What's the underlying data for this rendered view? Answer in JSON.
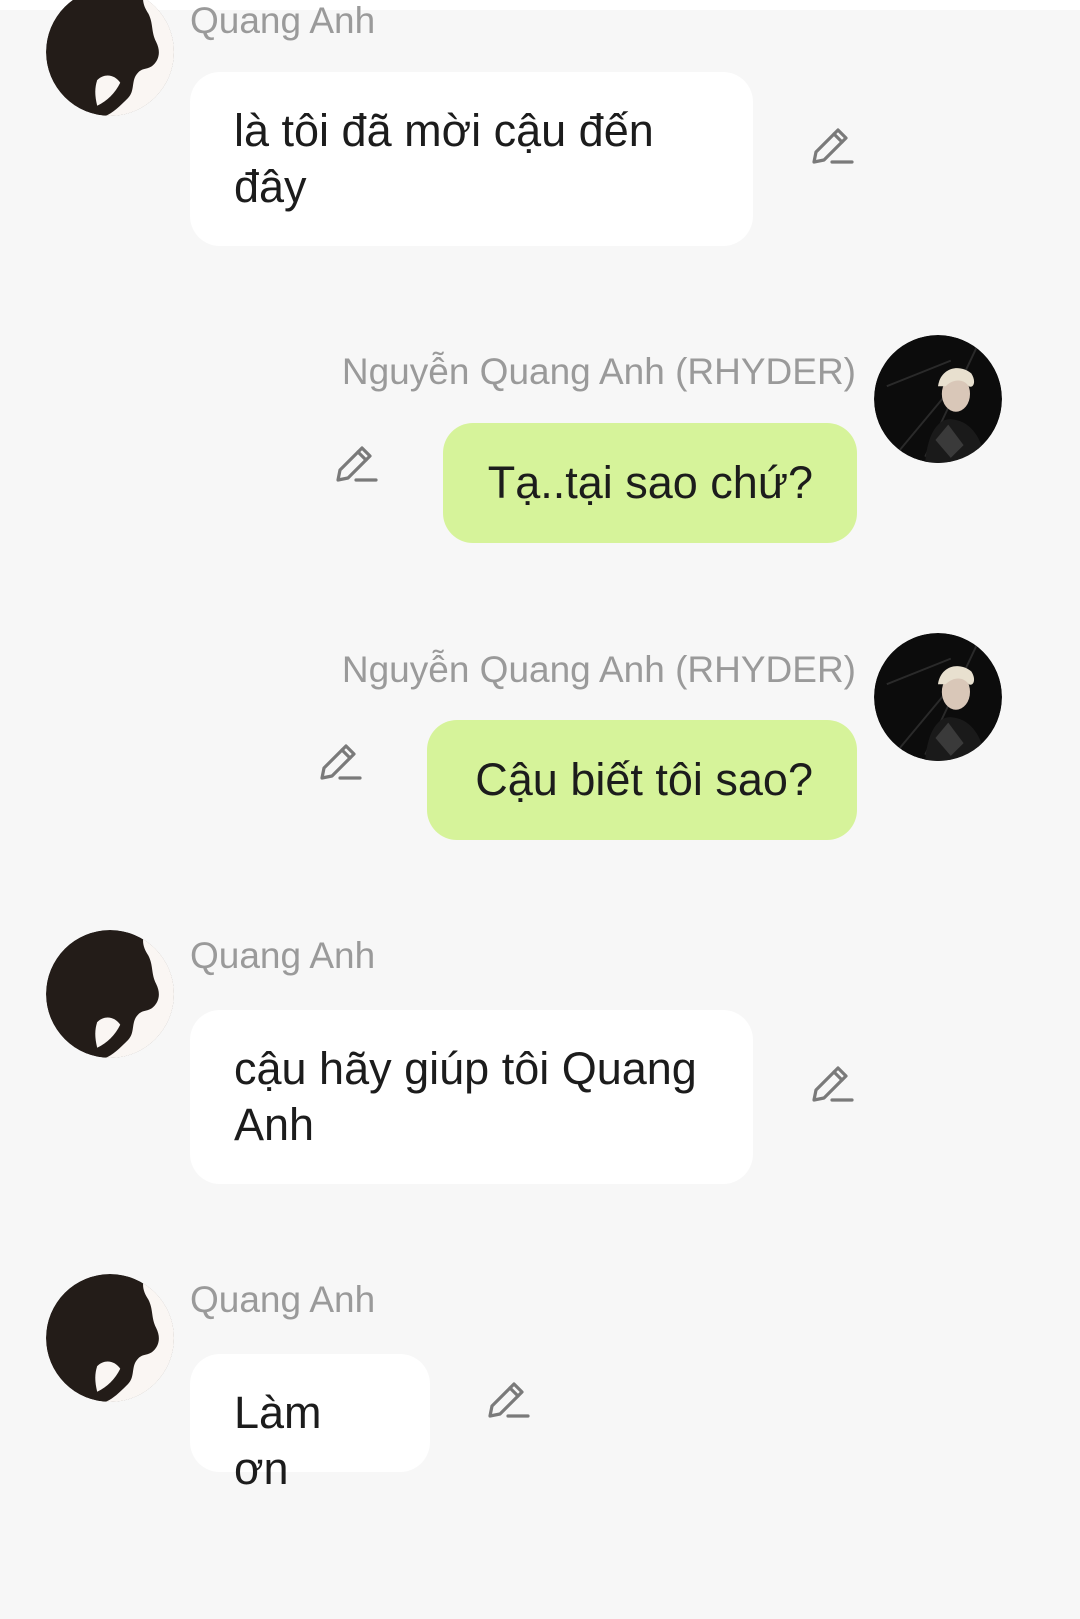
{
  "messages": [
    {
      "sender": "Quang Anh",
      "text": "là tôi đã mời cậu đến đây",
      "side": "left",
      "avatar": "silhouette-avatar"
    },
    {
      "sender": "Nguyễn Quang Anh (RHYDER)",
      "text": "Tạ..tại sao chứ?",
      "side": "right",
      "avatar": "photo-avatar"
    },
    {
      "sender": "Nguyễn Quang Anh (RHYDER)",
      "text": "Cậu biết tôi sao?",
      "side": "right",
      "avatar": "photo-avatar"
    },
    {
      "sender": "Quang Anh",
      "text": "cậu hãy giúp tôi Quang Anh",
      "side": "left",
      "avatar": "silhouette-avatar"
    },
    {
      "sender": "Quang Anh",
      "text": "Làm ơn",
      "side": "left",
      "avatar": "silhouette-avatar"
    }
  ],
  "icons": {
    "edit": "pencil-edit-icon"
  },
  "colors": {
    "background": "#f7f7f7",
    "bubble_left": "#ffffff",
    "bubble_right": "#d6f39a",
    "sender_text": "#9a9a9a"
  }
}
